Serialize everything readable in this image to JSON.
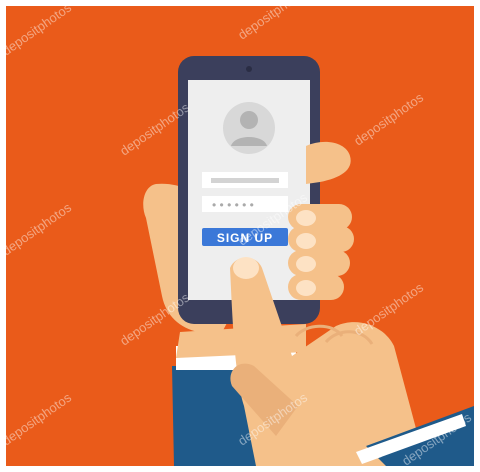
{
  "colors": {
    "background": "#ea5b1a",
    "phone_body": "#3b3f5c",
    "screen": "#eeeeee",
    "avatar_bg": "#d8d8d8",
    "avatar_fg": "#b3b3b3",
    "field": "#d3d3d3",
    "button": "#3b78d8",
    "skin": "#f5c18a",
    "skin_shade": "#eab07a",
    "sleeve": "#1f5a8a",
    "cuff": "#ffffff"
  },
  "login": {
    "username_placeholder": "",
    "password_mask": "• • • • • •",
    "signup_label": "SIGN UP"
  },
  "watermark": {
    "text": "depositphotos"
  }
}
